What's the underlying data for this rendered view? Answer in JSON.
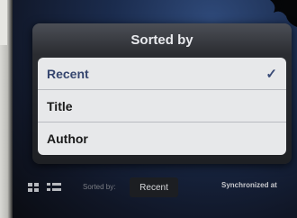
{
  "popover": {
    "title": "Sorted by",
    "options": [
      {
        "label": "Recent",
        "selected": true
      },
      {
        "label": "Title",
        "selected": false
      },
      {
        "label": "Author",
        "selected": false
      }
    ],
    "check_glyph": "✓"
  },
  "toolbar": {
    "grid_view_icon": "grid-icon",
    "list_view_icon": "list-icon",
    "sorted_by_label": "Sorted by:",
    "sort_value": "Recent",
    "sync_status": "Synchronized at"
  },
  "colors": {
    "popover_bg": "#1e2024",
    "list_bg": "#e7e8ea",
    "selected_text": "#36466f",
    "check": "#3a4b77"
  }
}
